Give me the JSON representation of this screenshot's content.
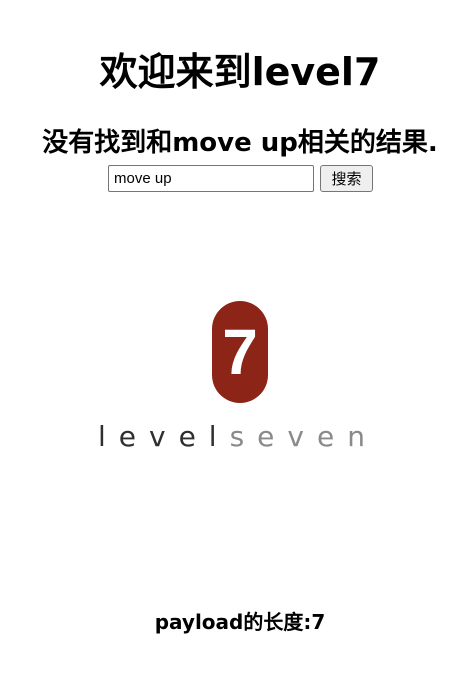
{
  "page": {
    "title": "欢迎来到level7",
    "result_message": "没有找到和move up相关的结果.",
    "payload_length_label": "payload的长度:7"
  },
  "search": {
    "input_value": "move up",
    "button_label": "搜索"
  },
  "logo": {
    "badge_text": "7",
    "word_dark": "level",
    "word_light": "seven",
    "badge_color": "#8c2418"
  }
}
